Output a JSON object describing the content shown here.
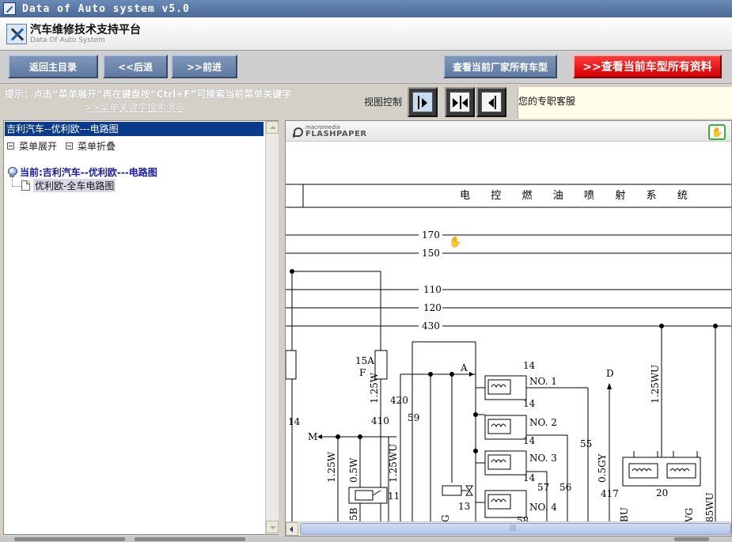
{
  "window": {
    "title": "Data of Auto system v5.0"
  },
  "header": {
    "brand_main": "汽车维修技术支持平台",
    "brand_sub": "Data Of Auto System"
  },
  "toolbar": {
    "home_label": "返回主目录",
    "back_label": "<<后退",
    "forward_label": ">>前进",
    "all_models_label": "查看当前厂家所有车型",
    "all_docs_label": ">>查看当前车型所有资料"
  },
  "hint": {
    "text": "提示：点击“菜单展开”再在键盘按“Ctrl+F”可搜索当前菜单关键字",
    "link": ">>菜单关键字搜索演示",
    "view_control": "视图控制",
    "service": "您的专职客服"
  },
  "left_panel": {
    "breadcrumb": "吉利汽车--优利欧---电路图",
    "expand_label": "菜单展开",
    "collapse_label": "菜单折叠",
    "tree_root": "当前:吉利汽车--优利欧---电路图",
    "tree_leaf": "优利欧-全车电路图"
  },
  "viewer": {
    "flash_brand_top": "macromedia",
    "flash_brand_bottom": "FLASHPAPER",
    "diagram": {
      "title": "电  控  燃  油  喷  射  系  统",
      "lines": [
        "170",
        "150",
        "110",
        "120",
        "430"
      ],
      "labels": {
        "fuse": "15A",
        "fuse_f": "F",
        "w125": "1.25W",
        "w125b": "1.25W",
        "w05": "0.5W",
        "w125wu": "1.25WU",
        "w125wu2": "1.25WU",
        "w05gy": "0.5GY",
        "w85wu": "85WU",
        "n420": "420",
        "n410": "410",
        "n59": "59",
        "n14": "14",
        "n14a": "14",
        "n14b": "14",
        "n14c": "14",
        "n14d": "14",
        "n55": "55",
        "n56": "56",
        "n57": "57",
        "n58": "58",
        "n11": "11",
        "n13": "13",
        "n20": "20",
        "n417": "417",
        "m": "M",
        "a": "A",
        "d": "D",
        "no1": "NO. 1",
        "no2": "NO. 2",
        "no3": "NO. 3",
        "no4": "NO. 4",
        "b5": "5B",
        "bu": "BU",
        "g1": "G",
        "vg": "VG"
      }
    }
  }
}
